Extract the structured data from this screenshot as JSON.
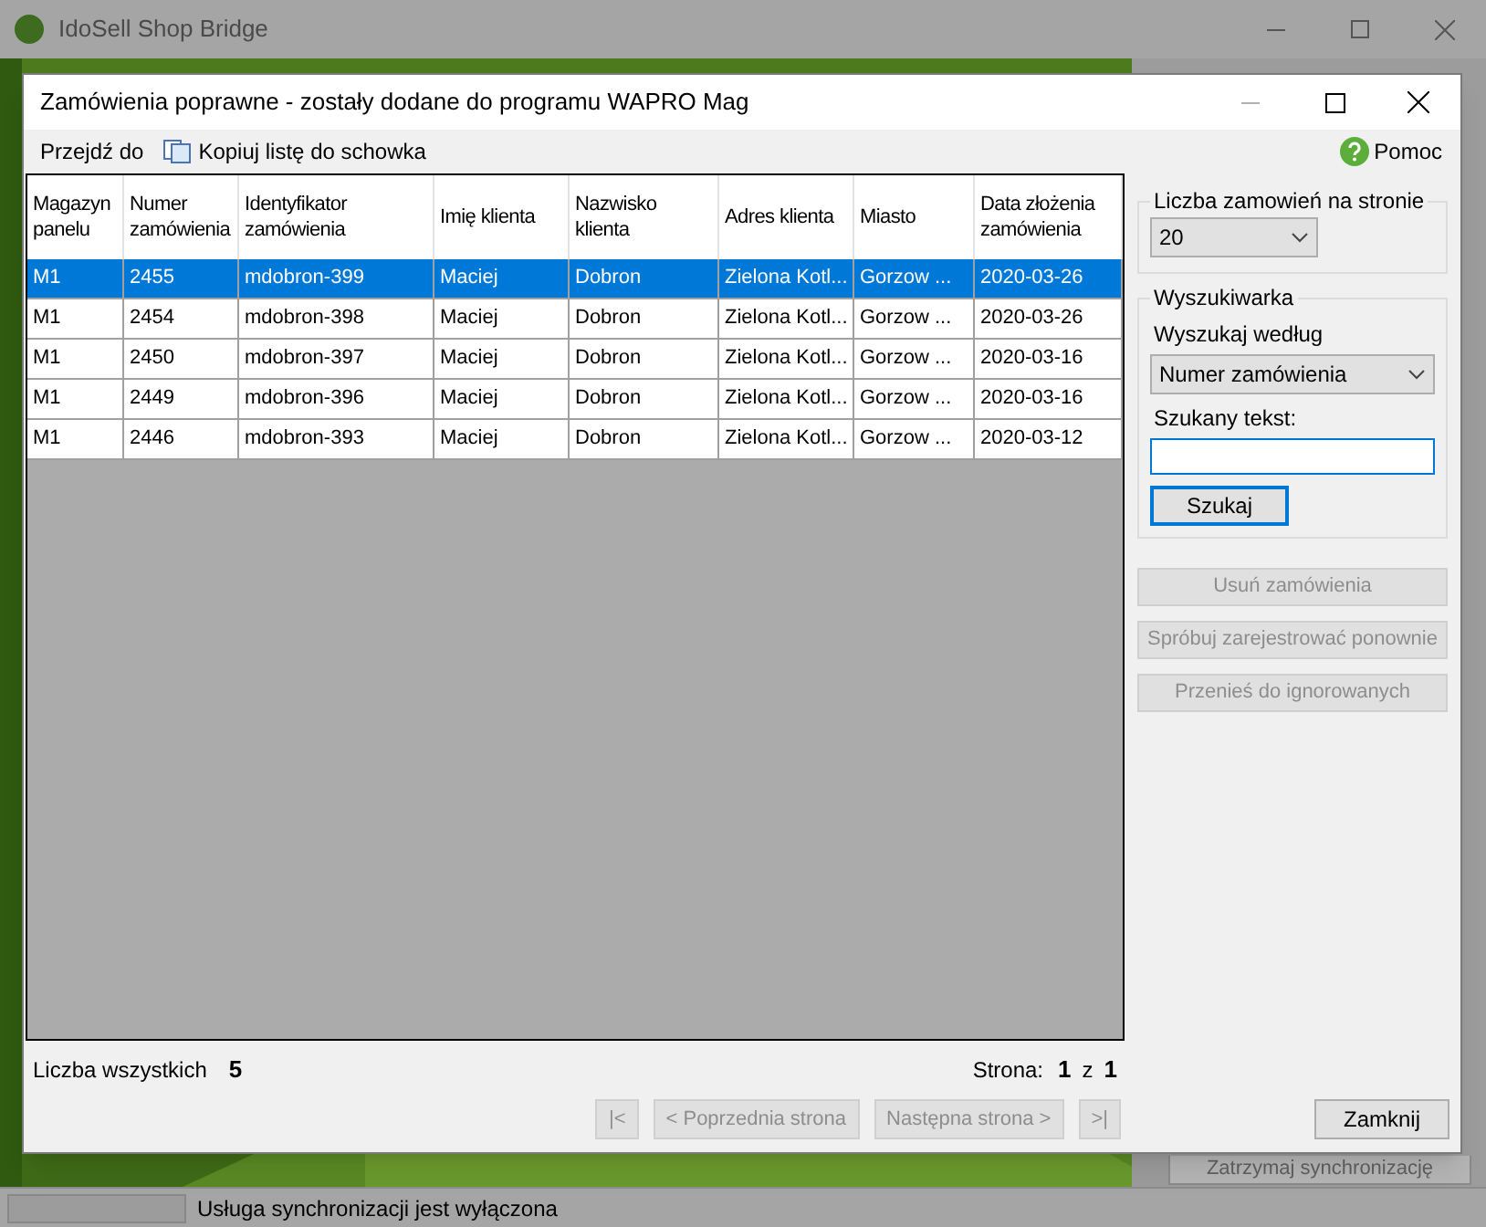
{
  "main_window": {
    "title": "IdoSell Shop Bridge",
    "buttons": [
      {
        "label": "Zatrzymaj synchronizację",
        "disabled": true
      }
    ],
    "status_bar": "Usługa synchronizacji jest wyłączona"
  },
  "dialog": {
    "title": "Zamówienia poprawne - zostały dodane do programu WAPRO Mag",
    "toolbar": [
      {
        "kind": "plain",
        "label": "Przejdź do"
      },
      {
        "kind": "copy",
        "label": "Kopiuj listę do schowka"
      }
    ],
    "help": "Pomoc",
    "table": {
      "columns": [
        "Magazyn panelu",
        "Numer zamówienia",
        "Identyfikator zamówienia",
        "Imię klienta",
        "Nazwisko klienta",
        "Adres klienta",
        "Miasto",
        "Data złożenia zamówienia"
      ],
      "rows": [
        {
          "selected": true,
          "cells": [
            "M1",
            "2455",
            "mdobron-399",
            "Maciej",
            "Dobron",
            "Zielona Kotl...",
            "Gorzow ...",
            "2020-03-26"
          ]
        },
        {
          "selected": false,
          "cells": [
            "M1",
            "2454",
            "mdobron-398",
            "Maciej",
            "Dobron",
            "Zielona Kotl...",
            "Gorzow ...",
            "2020-03-26"
          ]
        },
        {
          "selected": false,
          "cells": [
            "M1",
            "2450",
            "mdobron-397",
            "Maciej",
            "Dobron",
            "Zielona Kotl...",
            "Gorzow ...",
            "2020-03-16"
          ]
        },
        {
          "selected": false,
          "cells": [
            "M1",
            "2449",
            "mdobron-396",
            "Maciej",
            "Dobron",
            "Zielona Kotl...",
            "Gorzow ...",
            "2020-03-16"
          ]
        },
        {
          "selected": false,
          "cells": [
            "M1",
            "2446",
            "mdobron-393",
            "Maciej",
            "Dobron",
            "Zielona Kotl...",
            "Gorzow ...",
            "2020-03-12"
          ]
        }
      ]
    },
    "total_label": "Liczba wszystkich",
    "total_value": "5",
    "page_label": "Strona:",
    "page_current": "1",
    "page_of": "z",
    "page_total": "1",
    "nav_buttons": [
      {
        "label": "|<",
        "disabled": true
      },
      {
        "label": "< Poprzednia strona",
        "disabled": true
      },
      {
        "label": "Następna strona >",
        "disabled": true
      },
      {
        "label": ">|",
        "disabled": true
      }
    ],
    "per_page": {
      "legend": "Liczba zamowień na stronie",
      "value": "20"
    },
    "search": {
      "legend": "Wyszukiwarka",
      "by_label": "Wyszukaj według",
      "by_value": "Numer zamówienia",
      "text_label": "Szukany tekst:",
      "button": "Szukaj"
    },
    "actions": [
      {
        "label": "Usuń zamówienia",
        "disabled": true
      },
      {
        "label": "Spróbuj zarejestrować ponownie",
        "disabled": true
      },
      {
        "label": "Przenieś do ignorowanych",
        "disabled": true
      }
    ],
    "close_button": "Zamknij"
  }
}
